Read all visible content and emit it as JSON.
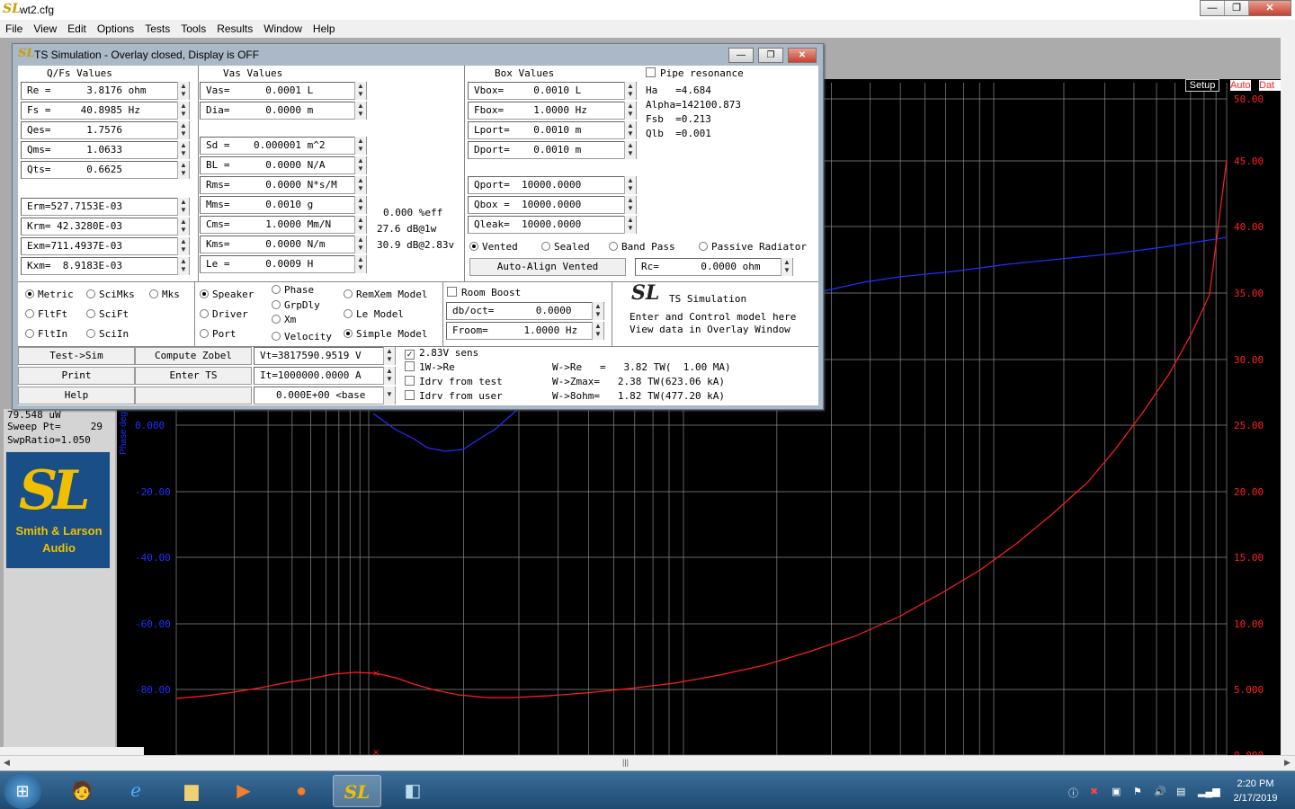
{
  "app": {
    "title": "wt2.cfg",
    "logo_text": "SL"
  },
  "window_buttons": {
    "min": "—",
    "max": "❐",
    "close": "✕"
  },
  "menu": [
    "File",
    "View",
    "Edit",
    "Options",
    "Tests",
    "Tools",
    "Results",
    "Window",
    "Help"
  ],
  "graph": {
    "setup": "Setup",
    "auto": "Auto",
    "dat": "Dat",
    "phase_axis_label": "Phase deg",
    "left_ticks": [
      "0.000",
      "-20.00",
      "-40.00",
      "-60.00",
      "-80.00"
    ],
    "right_ticks": [
      "50.00",
      "45.00",
      "40.00",
      "35.00",
      "30.00",
      "25.00",
      "20.00",
      "15.00",
      "10.00",
      "5.000",
      "0.000"
    ]
  },
  "left_panel": {
    "l1": "79.548 uW",
    "l2": "Sweep Pt=     29",
    "l3": "SwpRatio=1.050",
    "logo_top": "Smith & Larson",
    "logo_bottom": "Audio"
  },
  "dialog": {
    "title": "TS Simulation - Overlay closed, Display is OFF",
    "headers": {
      "qfs": "Q/Fs Values",
      "vas": "Vas Values",
      "box": "Box Values"
    },
    "qfs": [
      "Re =      3.8176 ohm",
      "Fs =     40.8985 Hz",
      "Qes=      1.7576",
      "Qms=      1.0633",
      "Qts=      0.6625"
    ],
    "erm": [
      "Erm=527.7153E-03",
      "Krm= 42.3280E-03",
      "Exm=711.4937E-03",
      "Kxm=  8.9183E-03"
    ],
    "vas": [
      "Vas=      0.0001 L",
      "Dia=      0.0000 m"
    ],
    "vas2": [
      "Sd =    0.000001 m^2",
      "BL =      0.0000 N/A",
      "Rms=      0.0000 N*s/M",
      "Mms=      0.0010 g",
      "Cms=      1.0000 Mm/N",
      "Kms=      0.0000 N/m",
      "Le =      0.0009 H"
    ],
    "eff": [
      "0.000 %eff",
      "27.6 dB@1w",
      "30.9 dB@2.83v"
    ],
    "box": [
      "Vbox=     0.0010 L",
      "Fbox=     1.0000 Hz",
      "Lport=    0.0010 m",
      "Dport=    0.0010 m"
    ],
    "box2": [
      "Qport=  10000.0000",
      "Qbox =  10000.0000",
      "Qleak=  10000.0000"
    ],
    "pipe": "Pipe resonance",
    "pipe_vals": [
      "Ha   =4.684",
      "Alpha=142100.873",
      "Fsb  =0.213",
      "Qlb  =0.001"
    ],
    "box_types": [
      "Vented",
      "Sealed",
      "Band Pass",
      "Passive Radiator"
    ],
    "auto_align": "Auto-Align Vented",
    "rc": "Rc=       0.0000 ohm",
    "units": [
      "Metric",
      "SciMks",
      "Mks",
      "FltFt",
      "SciFt",
      "FltIn",
      "SciIn"
    ],
    "display": [
      "Speaker",
      "Phase",
      "RemXem Model",
      "GrpDly",
      "Driver",
      "Xm",
      "Le Model",
      "Port",
      "Velocity",
      "Simple Model"
    ],
    "room_boost": "Room Boost",
    "dboct": "db/oct=       0.0000",
    "froom": "Froom=      1.0000 Hz",
    "ts_title": "TS Simulation",
    "ts_desc1": "Enter and Control model here",
    "ts_desc2": "View data in Overlay Window",
    "buttons": [
      "Test->Sim",
      "Compute Zobel",
      "Print",
      "Enter TS",
      "Help"
    ],
    "vt": "Vt=3817590.9519 V",
    "it": "It=1000000.0000 A",
    "base": "0.000E+00 <base",
    "checks": [
      "2.83V sens",
      "1W->Re",
      "Idrv from test",
      "Idrv from user"
    ],
    "w_results": [
      "W->Re   =   3.82 TW(  1.00 MA)",
      "W->Zmax=   2.38 TW(623.06 kA)",
      "W->8ohm=   1.82 TW(477.20 kA)"
    ]
  },
  "taskbar": {
    "time": "2:20 PM",
    "date": "2/17/2019"
  },
  "colors": {
    "red": "#ff2020",
    "blue": "#2030ff",
    "grid": "#8a8a8a"
  }
}
